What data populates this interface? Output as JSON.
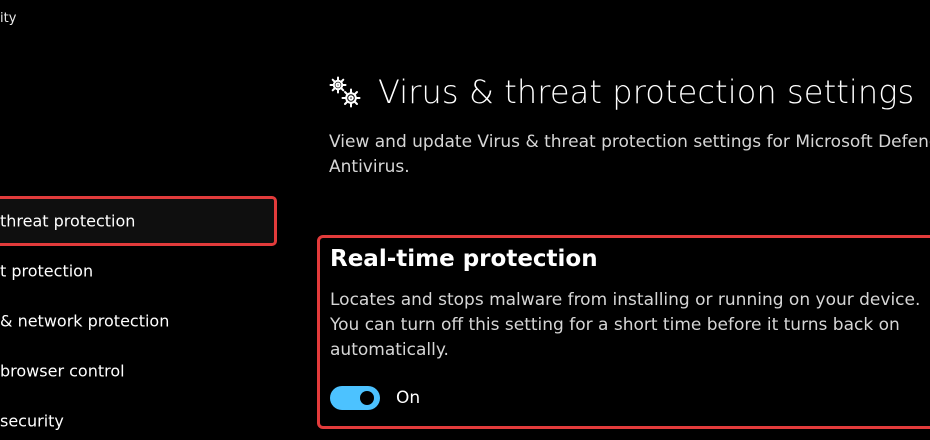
{
  "app": {
    "title": "ity"
  },
  "sidebar": {
    "items": [
      {
        "label": "threat protection",
        "selected": true
      },
      {
        "label": "t protection"
      },
      {
        "label": "& network protection"
      },
      {
        "label": "browser control"
      },
      {
        "label": "security"
      }
    ]
  },
  "main": {
    "icon": "gears-icon",
    "title": "Virus & threat protection settings",
    "description": "View and update Virus & threat protection settings for Microsoft Defender Antivirus.",
    "section": {
      "title": "Real-time protection",
      "description": "Locates and stops malware from installing or running on your device. You can turn off this setting for a short time before it turns back on automatically.",
      "toggle": {
        "state_label": "On",
        "on": true
      }
    }
  },
  "colors": {
    "accent": "#4cc2ff",
    "highlight": "#e23b3b",
    "background": "#000000"
  }
}
